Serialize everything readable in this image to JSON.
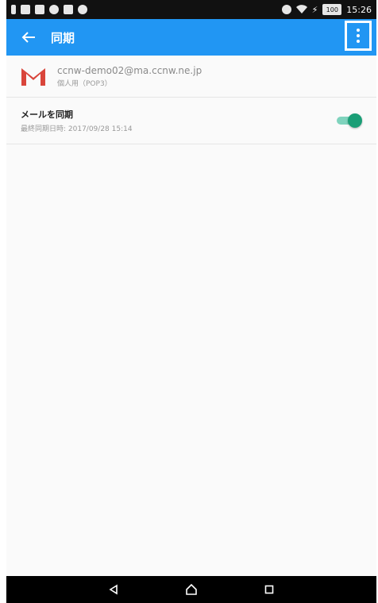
{
  "status_bar": {
    "time": "15:26",
    "battery": "100",
    "icons_left": [
      "sim-icon",
      "screenshot-icon",
      "mail-icon",
      "chrome-icon",
      "photo-icon",
      "settings-icon"
    ],
    "icons_right": [
      "mute-icon",
      "wifi-icon",
      "charging-icon"
    ]
  },
  "app_bar": {
    "title": "同期",
    "back_icon": "arrow-left-icon",
    "overflow_icon": "more-vert-icon",
    "color": "#2196f3"
  },
  "account": {
    "email": "ccnw-demo02@ma.ccnw.ne.jp",
    "type": "個人用（POP3）",
    "icon": "gmail-icon"
  },
  "sync_setting": {
    "title": "メールを同期",
    "last_sync": "最終同期日時: 2017/09/28 15:14",
    "enabled": true,
    "accent": "#1a9e76"
  },
  "nav_bar": {
    "buttons": [
      "back-triangle-icon",
      "home-icon",
      "recents-icon"
    ]
  }
}
